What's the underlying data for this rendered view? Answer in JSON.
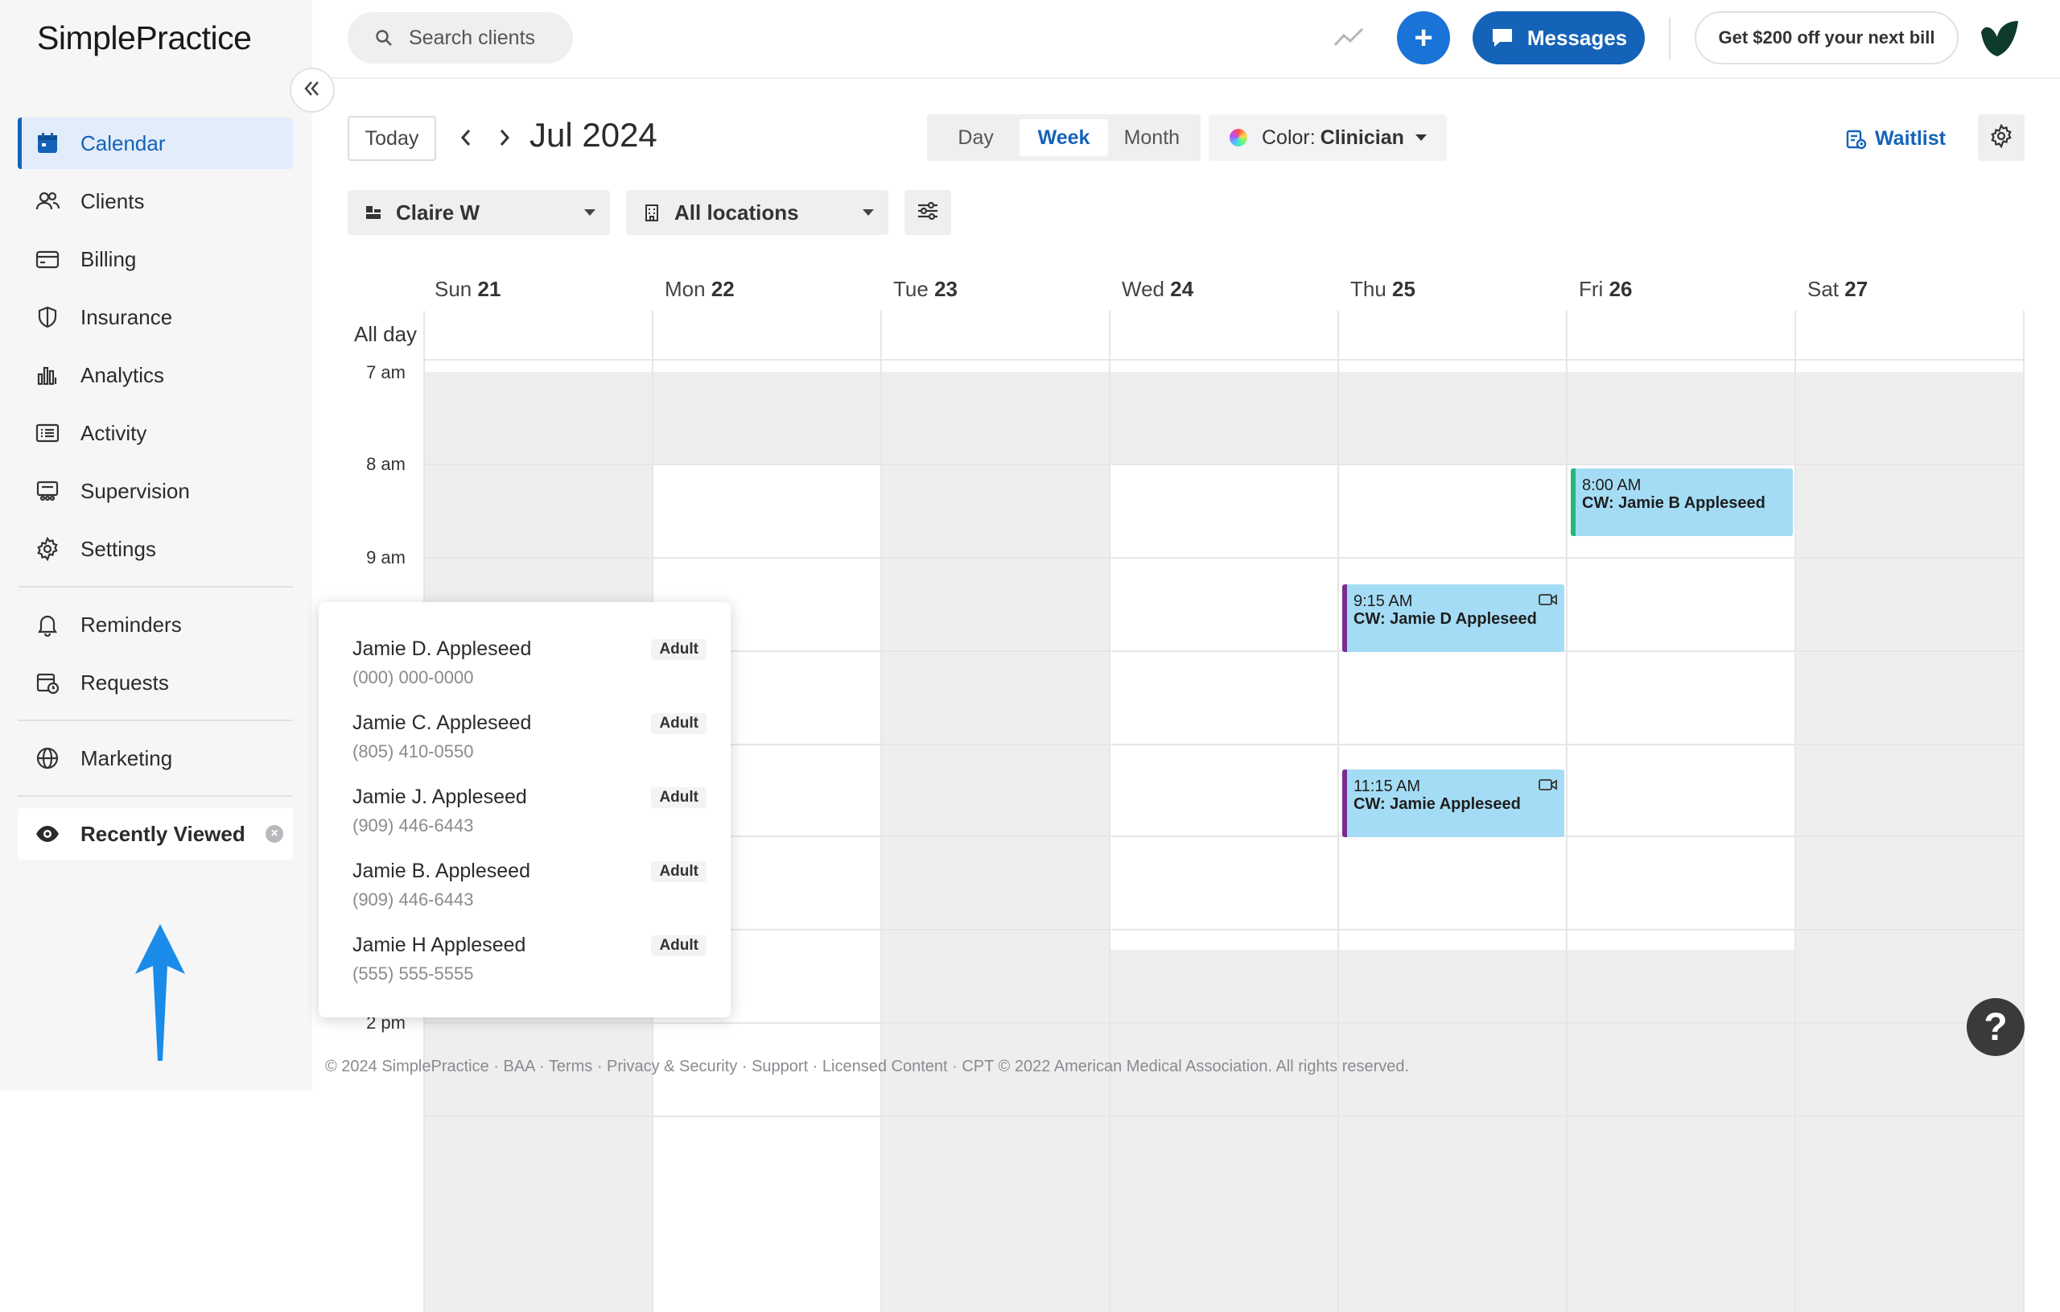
{
  "app": {
    "logo": "SimplePractice"
  },
  "sidebar": {
    "items": [
      {
        "label": "Calendar"
      },
      {
        "label": "Clients"
      },
      {
        "label": "Billing"
      },
      {
        "label": "Insurance"
      },
      {
        "label": "Analytics"
      },
      {
        "label": "Activity"
      },
      {
        "label": "Supervision"
      },
      {
        "label": "Settings"
      }
    ],
    "secondary": [
      {
        "label": "Reminders"
      },
      {
        "label": "Requests"
      }
    ],
    "marketing": {
      "label": "Marketing"
    },
    "recently_viewed": {
      "label": "Recently Viewed"
    }
  },
  "topbar": {
    "search_placeholder": "Search clients",
    "messages_label": "Messages",
    "promo_label": "Get $200 off your next bill",
    "plus_symbol": "+"
  },
  "toolbar": {
    "today_label": "Today",
    "month_title": "Jul 2024",
    "views": [
      "Day",
      "Week",
      "Month"
    ],
    "selected_view": "Week",
    "color_label": "Color: ",
    "color_value": "Clinician",
    "waitlist_label": "Waitlist",
    "clinician": "Claire W",
    "location": "All locations"
  },
  "calendar": {
    "days": [
      {
        "dow": "Sun",
        "date": "21"
      },
      {
        "dow": "Mon",
        "date": "22"
      },
      {
        "dow": "Tue",
        "date": "23"
      },
      {
        "dow": "Wed",
        "date": "24"
      },
      {
        "dow": "Thu",
        "date": "25"
      },
      {
        "dow": "Fri",
        "date": "26"
      },
      {
        "dow": "Sat",
        "date": "27"
      }
    ],
    "all_day_label": "All day",
    "times": [
      "7 am",
      "8 am",
      "9 am",
      "2 pm"
    ],
    "events": [
      {
        "time": "8:00 AM",
        "title": "CW: Jamie B Appleseed",
        "day": "Fri",
        "bar_color": "#27b67a"
      },
      {
        "time": "9:15 AM",
        "title": "CW: Jamie D Appleseed",
        "day": "Thu",
        "bar_color": "#7b2d8e"
      },
      {
        "time": "11:15 AM",
        "title": "CW: Jamie Appleseed",
        "day": "Thu",
        "bar_color": "#7b2d8e"
      }
    ]
  },
  "recent_popup": {
    "items": [
      {
        "name": "Jamie D. Appleseed",
        "phone": "(000) 000-0000",
        "tag": "Adult"
      },
      {
        "name": "Jamie C. Appleseed",
        "phone": "(805) 410-0550",
        "tag": "Adult"
      },
      {
        "name": "Jamie J. Appleseed",
        "phone": "(909) 446-6443",
        "tag": "Adult"
      },
      {
        "name": "Jamie B. Appleseed",
        "phone": "(909) 446-6443",
        "tag": "Adult"
      },
      {
        "name": "Jamie H Appleseed",
        "phone": "(555) 555-5555",
        "tag": "Adult"
      }
    ]
  },
  "footer": {
    "text": "© 2024 SimplePractice · BAA · Terms · Privacy & Security · Support · Licensed Content · CPT © 2022 American Medical Association. All rights reserved."
  },
  "help": {
    "symbol": "?"
  },
  "colors": {
    "accent": "#1463b8",
    "event_fill": "#a4dcf5",
    "annotation_arrow": "#1a8be8"
  }
}
